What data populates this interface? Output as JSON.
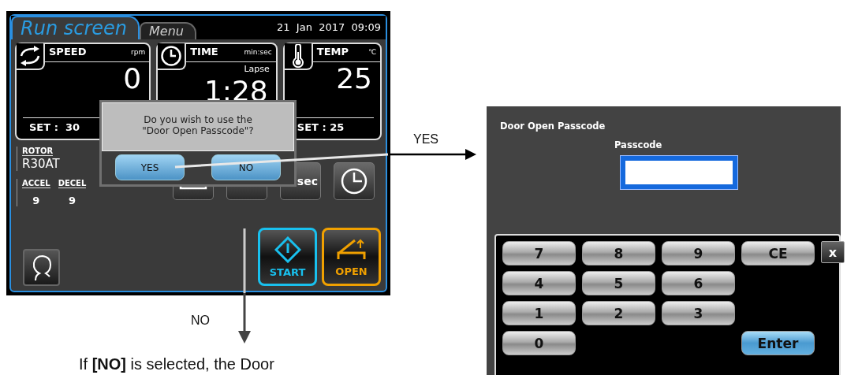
{
  "run_screen": {
    "tabs": [
      {
        "label": "Run screen",
        "selected": true
      },
      {
        "label": "Menu",
        "selected": false
      }
    ],
    "datetime": "21  Jan  2017  09:09",
    "cards": [
      {
        "kind": "speed",
        "label": "SPEED",
        "unit": "rpm",
        "value": "0",
        "set": "SET :  30"
      },
      {
        "kind": "time",
        "label": "TIME",
        "unit": "min:sec",
        "sublabel": "Lapse",
        "value": "1:28"
      },
      {
        "kind": "temp",
        "label": "TEMP",
        "unit": "℃",
        "value": "25",
        "set": "SET : 25"
      }
    ],
    "rotor": {
      "label": "ROTOR",
      "value": "R30AT"
    },
    "rates": [
      {
        "label": "ACCEL",
        "value": "9"
      },
      {
        "label": "DECEL",
        "value": "9"
      }
    ],
    "tool_buttons": [
      {
        "kind": "tray"
      },
      {
        "kind": "blank"
      },
      {
        "kind": "text",
        "label": "sec"
      },
      {
        "kind": "clock"
      }
    ],
    "actions": [
      {
        "kind": "start",
        "label": "START"
      },
      {
        "kind": "open",
        "label": "OPEN"
      }
    ],
    "dialog": {
      "message": "Do you wish to use the\n\"Door Open Passcode\"?",
      "buttons": [
        "YES",
        "NO"
      ]
    }
  },
  "flow": {
    "yes_label": "YES",
    "no_label": "NO",
    "note": "If **[NO]** is selected, the Door"
  },
  "passcode_screen": {
    "title": "Door Open Passcode",
    "field_label": "Passcode",
    "keypad": [
      [
        {
          "kind": "key",
          "label": "7"
        },
        {
          "kind": "key",
          "label": "8"
        },
        {
          "kind": "key",
          "label": "9"
        },
        {
          "kind": "key",
          "label": "CE"
        },
        {
          "kind": "close",
          "label": "x"
        }
      ],
      [
        {
          "kind": "key",
          "label": "4"
        },
        {
          "kind": "key",
          "label": "5"
        },
        {
          "kind": "key",
          "label": "6"
        }
      ],
      [
        {
          "kind": "key",
          "label": "1"
        },
        {
          "kind": "key",
          "label": "2"
        },
        {
          "kind": "key",
          "label": "3"
        }
      ],
      [
        {
          "kind": "key",
          "label": "0"
        },
        {
          "kind": "enter",
          "label": "Enter"
        }
      ]
    ]
  }
}
